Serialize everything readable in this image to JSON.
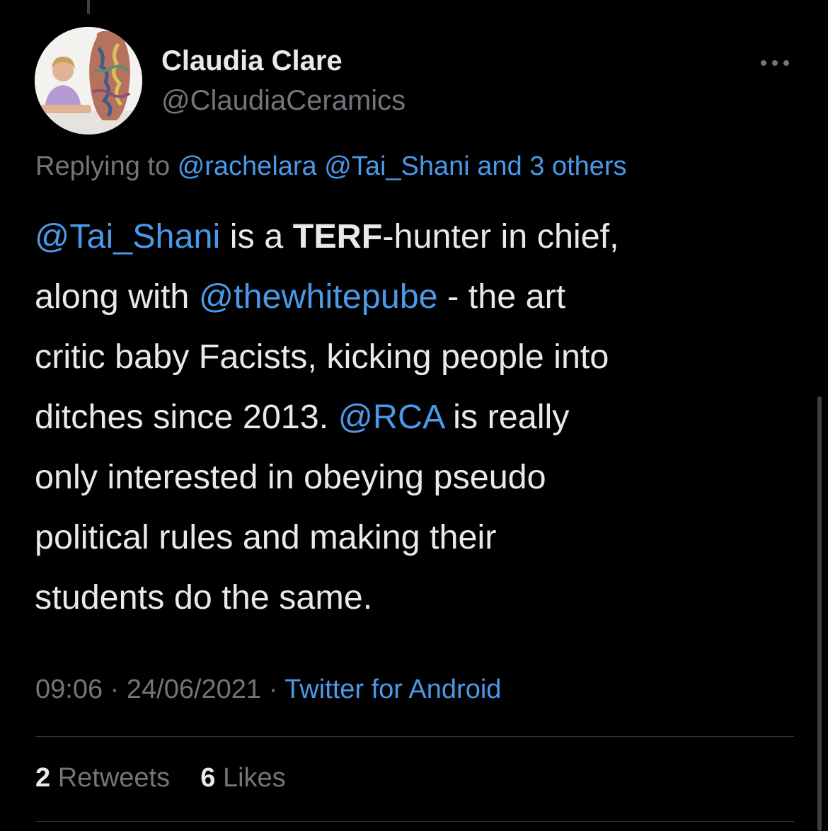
{
  "author": {
    "display_name": "Claudia Clare",
    "handle": "@ClaudiaCeramics",
    "avatar_icon": "profile-photo-with-vase"
  },
  "more_icon": "more-horizontal-icon",
  "reply": {
    "prefix": "Replying to",
    "mentions": [
      "@rachelara",
      "@Tai_Shani"
    ],
    "others": "and 3 others"
  },
  "tweet": {
    "lines": [
      [
        {
          "text": "@Tai_Shani",
          "type": "mention"
        },
        {
          "text": " is a ",
          "type": "text"
        },
        {
          "text": "TERF",
          "type": "bold"
        },
        {
          "text": "-hunter in chief,",
          "type": "text"
        }
      ],
      [
        {
          "text": "along with ",
          "type": "text"
        },
        {
          "text": "@thewhitepube",
          "type": "mention"
        },
        {
          "text": " - the art",
          "type": "text"
        }
      ],
      [
        {
          "text": "critic baby Facists, kicking people into",
          "type": "text"
        }
      ],
      [
        {
          "text": "ditches since 2013. ",
          "type": "text"
        },
        {
          "text": "@RCA",
          "type": "mention"
        },
        {
          "text": " is really",
          "type": "text"
        }
      ],
      [
        {
          "text": "only interested in obeying pseudo",
          "type": "text"
        }
      ],
      [
        {
          "text": "political rules and making their",
          "type": "text"
        }
      ],
      [
        {
          "text": "students do the same.",
          "type": "text"
        }
      ]
    ]
  },
  "meta": {
    "time": "09:06",
    "separator": " · ",
    "date": "24/06/2021",
    "source": "Twitter for Android"
  },
  "stats": {
    "retweets_count": "2",
    "retweets_label": "Retweets",
    "likes_count": "6",
    "likes_label": "Likes"
  },
  "colors": {
    "background": "#000000",
    "primary_text": "#e7e9ea",
    "secondary_text": "#71767b",
    "link": "#4a99e9",
    "divider": "#2f3336"
  }
}
